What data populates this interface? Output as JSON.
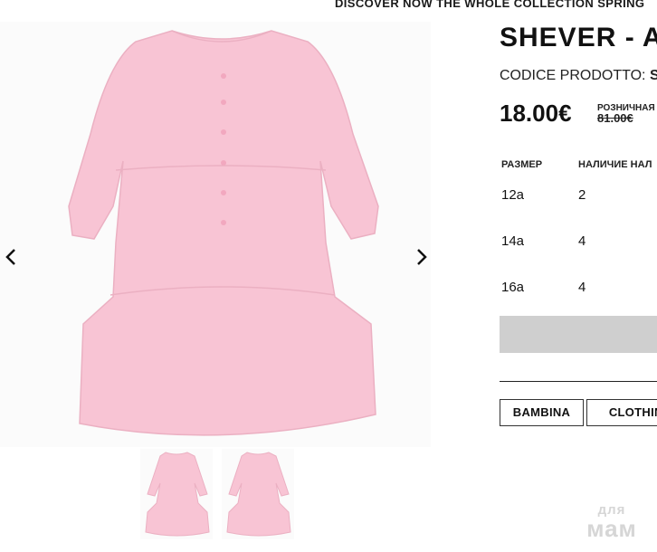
{
  "promo": {
    "text": "DISCOVER NOW THE WHOLE COLLECTION SPRING"
  },
  "product": {
    "title": "SHEVER - A",
    "code_label": "CODICE PRODOTTO:",
    "code_value": "SH",
    "price": "18.00€",
    "retail_label": "РОЗНИЧНАЯ",
    "retail_value": "81.00€"
  },
  "sizes": {
    "headers": {
      "size": "РАЗМЕР",
      "stock": "НАЛИЧИЕ НАЛ"
    },
    "rows": [
      {
        "size": "12a",
        "stock": "2"
      },
      {
        "size": "14a",
        "stock": "4"
      },
      {
        "size": "16a",
        "stock": "4"
      }
    ]
  },
  "tags": [
    "BAMBINA",
    "CLOTHING"
  ],
  "watermark": {
    "line1": "для",
    "line2": "мам"
  },
  "icons": {
    "prev": "chevron-left-icon",
    "next": "chevron-right-icon"
  },
  "colors": {
    "dress": "#f8c4d4",
    "button": "#cfcfcf"
  }
}
